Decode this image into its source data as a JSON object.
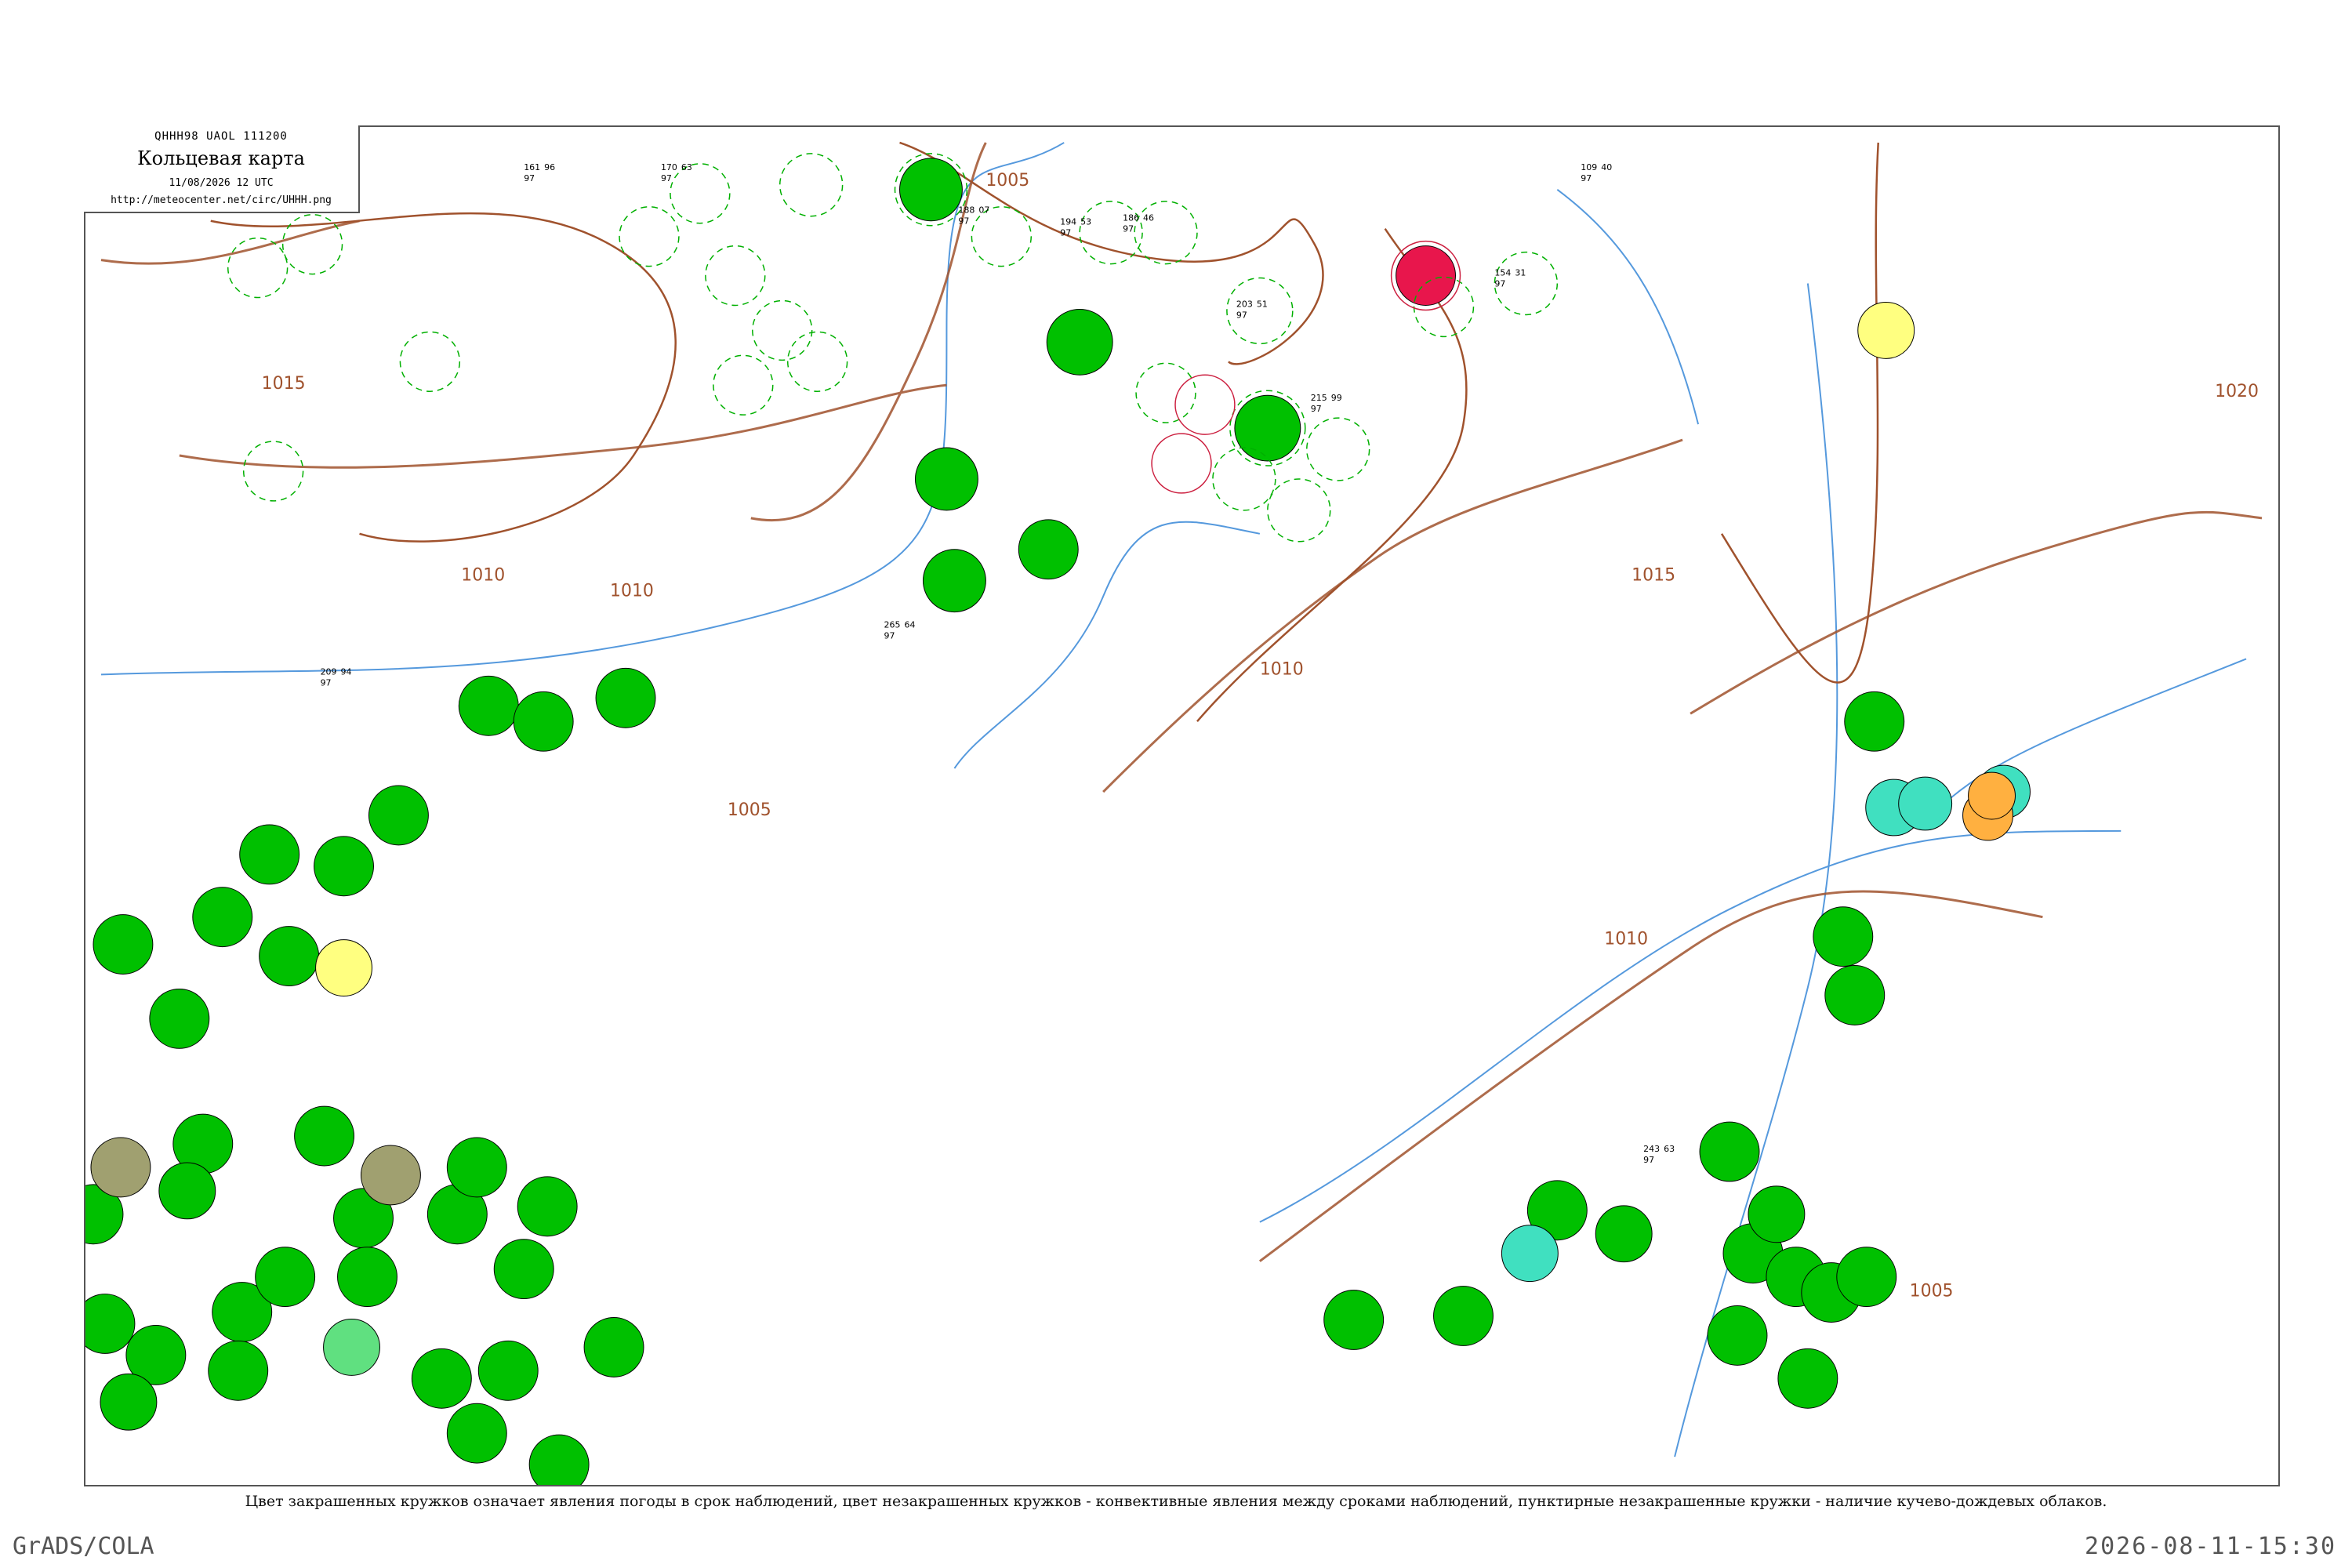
{
  "header": {
    "code": "QHHH98  UAOL  111200",
    "title": "Кольцевая карта",
    "time": "11/08/2026 12 UTC",
    "url": "http://meteocenter.net/circ/UHHH.png"
  },
  "isobars": [
    {
      "label": "1005"
    },
    {
      "label": "1010"
    },
    {
      "label": "1015"
    },
    {
      "label": "1020"
    }
  ],
  "map": {
    "colors": {
      "rain": "#00c000",
      "fog": "#ffff80",
      "thunder": "#e8164c",
      "shower_snow": "#40e0c0",
      "haze": "#a0a070",
      "drizzle": "#ffb040",
      "isobar": "#a0522d",
      "river": "#5599dd"
    },
    "stations": [
      {
        "p": "161",
        "t": "97",
        "d": "96"
      },
      {
        "p": "170",
        "t": "97",
        "d": "63"
      },
      {
        "p": "188",
        "t": "97",
        "d": "07"
      },
      {
        "p": "194",
        "t": "97",
        "d": "53"
      },
      {
        "p": "186",
        "t": "97",
        "d": "46"
      },
      {
        "p": "203",
        "t": "97",
        "d": "51"
      },
      {
        "p": "215",
        "t": "97",
        "d": "99"
      },
      {
        "p": "154",
        "t": "97",
        "d": "31"
      },
      {
        "p": "109",
        "t": "97",
        "d": "40"
      },
      {
        "p": "209",
        "t": "97",
        "d": "94"
      },
      {
        "p": "265",
        "t": "97",
        "d": "64"
      },
      {
        "p": "243",
        "t": "97",
        "d": "63"
      }
    ]
  },
  "caption": "Цвет закрашенных кружков означает явления погоды в срок наблюдений, цвет незакрашенных кружков - конвективные явления между сроками наблюдений, пунктирные незакрашенные кружки - наличие кучево-дождевых облаков.",
  "footer": {
    "left": "GrADS/COLA",
    "right": "2026-08-11-15:30"
  }
}
